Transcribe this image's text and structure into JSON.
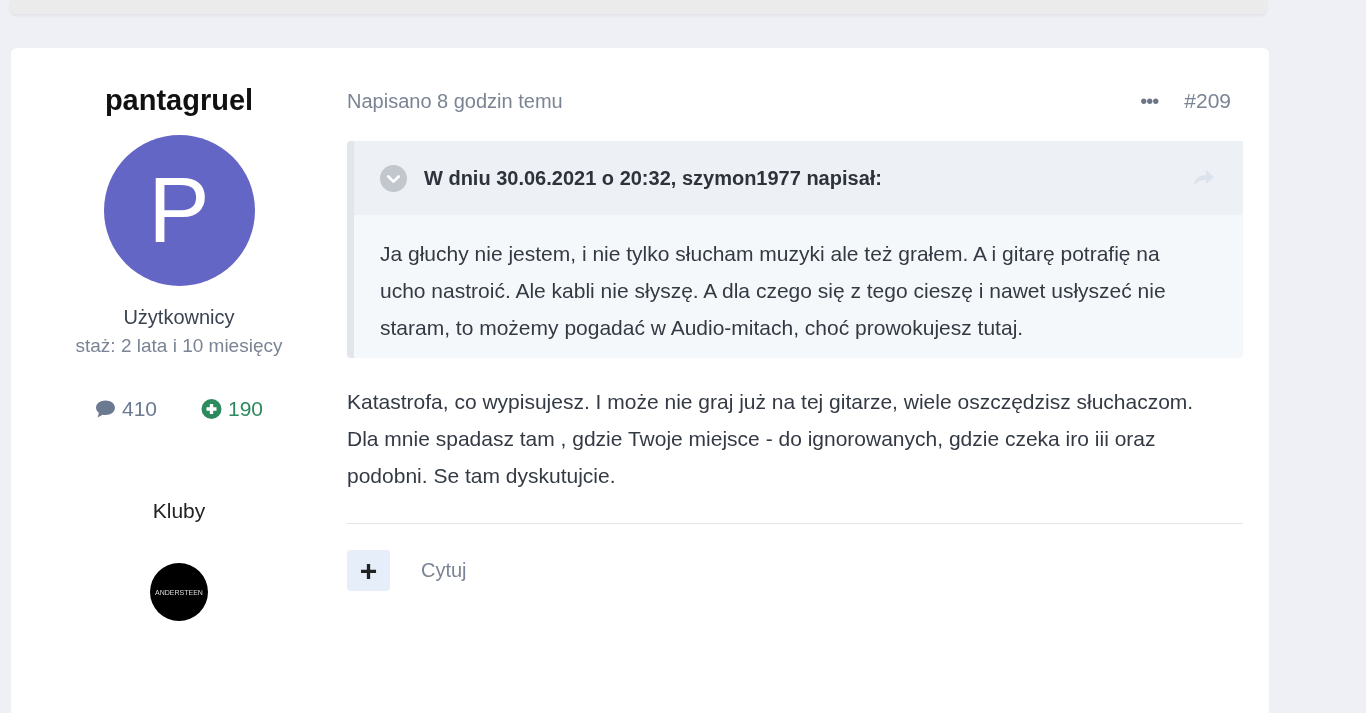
{
  "author": {
    "name": "pantagruel",
    "avatar_letter": "P",
    "group": "Użytkownicy",
    "tenure": "staż: 2 lata i 10 miesięcy",
    "posts": "410",
    "reputation": "190",
    "clubs_label": "Kluby",
    "club_logo_text": "ANDERSTEEN"
  },
  "post": {
    "posted": "Napisano 8 godzin temu",
    "menu": "•••",
    "number": "#209",
    "quote": {
      "expanded": true,
      "header": "W dniu 30.06.2021 o 20:32, szymon1977 napisał:",
      "text": "Ja głuchy nie jestem, i nie tylko słucham muzyki ale też grałem. A i gitarę potrafię na ucho nastroić. Ale kabli nie słyszę. A dla czego się z tego cieszę i nawet usłyszeć nie staram, to możemy pogadać w Audio-mitach, choć prowokujesz tutaj."
    },
    "body": "Katastrofa, co wypisujesz. I może nie graj już na tej gitarze, wiele oszczędzisz słuchaczom. Dla mnie spadasz tam , gdzie Twoje miejsce - do ignorowanych, gdzie czeka iro iii oraz podobni. Se tam dyskutujcie.",
    "actions": {
      "add": "+",
      "quote": "Cytuj"
    }
  }
}
